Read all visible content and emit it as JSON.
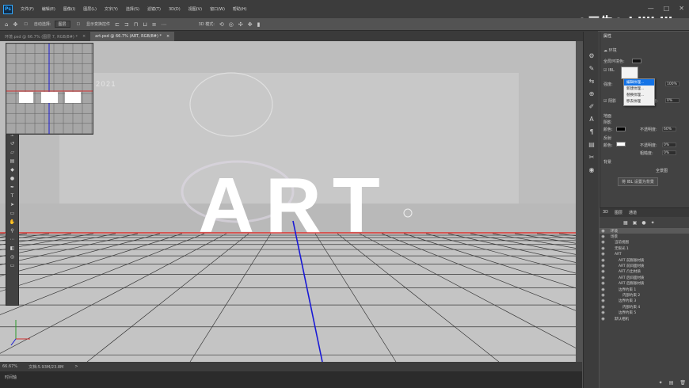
{
  "app": {
    "logo": "Ps"
  },
  "menu": [
    "文件(F)",
    "编辑(E)",
    "图像(I)",
    "图层(L)",
    "文字(Y)",
    "选择(S)",
    "滤镜(T)",
    "3D(D)",
    "视图(V)",
    "窗口(W)",
    "帮助(H)"
  ],
  "window_controls": [
    "—",
    "□",
    "✕"
  ],
  "options_bar": {
    "auto_select_label": "自动选择:",
    "auto_select_value": "图层",
    "transform_label": "显示变换控件",
    "mode_label": "3D 模式:"
  },
  "tabs": [
    {
      "label": "环境.psd @ 66.7% (图层 7, RGB/8#) *",
      "close": "×",
      "active": false
    },
    {
      "label": "art.psd @ 66.7% (ART, RGB/8#) *",
      "close": "×",
      "active": true
    }
  ],
  "canvas": {
    "title_text": "ART",
    "year_text": "2021",
    "accent_colors": {
      "ground_line": "#e41b17",
      "axis_line": "#1a1ad6"
    }
  },
  "status": {
    "zoom": "66.67%",
    "doc": "文档:5.93M/23.8M",
    "arrow": ">"
  },
  "timeline": {
    "label": "时间轴"
  },
  "watermark": {
    "text": "○三牛○ bilibili"
  },
  "properties": {
    "title": "属性",
    "env_label": "环境",
    "global_ambient": "全局环境色:",
    "ibl_label": "IBL",
    "intensity_label": "强度:",
    "intensity_value": "100%",
    "shadow_label": "阴影",
    "softness_label": "柔和度:",
    "softness_value": "0%",
    "ground_plane": "地面",
    "shadow_section": "阴影",
    "color_label": "颜色:",
    "opacity_label": "不透明度:",
    "opacity_value": "60%",
    "reflection_label": "反射",
    "reflection_opacity_value": "0%",
    "roughness_label": "粗糙度:",
    "roughness_value": "0%",
    "background_label": "背景",
    "panorama_label": "全景图",
    "set_bg_button": "将 IBL 设置为背景"
  },
  "context_menu": {
    "items": [
      "编辑纹理...",
      "新建纹理...",
      "替换纹理...",
      "移去纹理"
    ],
    "highlighted": 0
  },
  "layers_panel": {
    "tabs": [
      "3D",
      "图层",
      "通道"
    ],
    "rows": [
      {
        "label": "环境",
        "indent": 1,
        "selected": true
      },
      {
        "label": "场景",
        "indent": 1
      },
      {
        "label": "当前视图",
        "indent": 2
      },
      {
        "label": "无限光 1",
        "indent": 2
      },
      {
        "label": "ART",
        "indent": 2
      },
      {
        "label": "ART 前膨胀材质",
        "indent": 3
      },
      {
        "label": "ART 前斜面材质",
        "indent": 3
      },
      {
        "label": "ART 凸出材质",
        "indent": 3
      },
      {
        "label": "ART 后斜面材质",
        "indent": 3
      },
      {
        "label": "ART 后膨胀材质",
        "indent": 3
      },
      {
        "label": "边界约束 1",
        "indent": 3
      },
      {
        "label": "内部约束 2",
        "indent": 4
      },
      {
        "label": "边界约束 3",
        "indent": 3
      },
      {
        "label": "内部约束 4",
        "indent": 4
      },
      {
        "label": "边界约束 5",
        "indent": 3
      },
      {
        "label": "默认相机",
        "indent": 2
      }
    ]
  }
}
